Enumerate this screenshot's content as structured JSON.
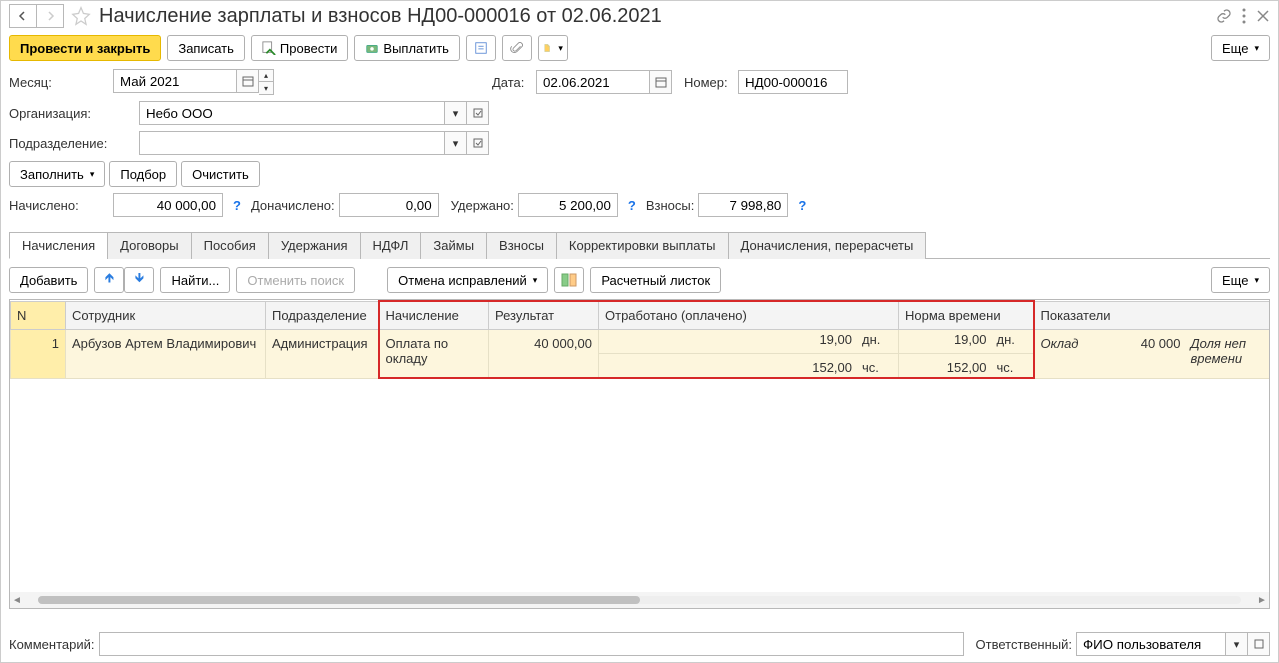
{
  "title": "Начисление зарплаты и взносов НД00-000016 от 02.06.2021",
  "toolbar": {
    "post_close": "Провести и закрыть",
    "save": "Записать",
    "post": "Провести",
    "pay": "Выплатить",
    "more": "Еще"
  },
  "fields": {
    "month_label": "Месяц:",
    "month_value": "Май 2021",
    "date_label": "Дата:",
    "date_value": "02.06.2021",
    "number_label": "Номер:",
    "number_value": "НД00-000016",
    "org_label": "Организация:",
    "org_value": "Небо ООО",
    "dept_label": "Подразделение:",
    "dept_value": ""
  },
  "actions": {
    "fill": "Заполнить",
    "pick": "Подбор",
    "clear": "Очистить"
  },
  "totals": {
    "accrued_label": "Начислено:",
    "accrued_value": "40 000,00",
    "extra_label": "Доначислено:",
    "extra_value": "0,00",
    "withheld_label": "Удержано:",
    "withheld_value": "5 200,00",
    "contrib_label": "Взносы:",
    "contrib_value": "7 998,80"
  },
  "tabs": [
    "Начисления",
    "Договоры",
    "Пособия",
    "Удержания",
    "НДФЛ",
    "Займы",
    "Взносы",
    "Корректировки выплаты",
    "Доначисления, перерасчеты"
  ],
  "tab_toolbar": {
    "add": "Добавить",
    "find": "Найти...",
    "cancel_search": "Отменить поиск",
    "cancel_fix": "Отмена исправлений",
    "payslip": "Расчетный листок",
    "more": "Еще"
  },
  "columns": {
    "n": "N",
    "employee": "Сотрудник",
    "department": "Подразделение",
    "accrual": "Начисление",
    "result": "Результат",
    "worked": "Отработано (оплачено)",
    "norm": "Норма времени",
    "indicators": "Показатели"
  },
  "row": {
    "n": "1",
    "employee": "Арбузов Артем Владимирович",
    "department": "Администрация",
    "accrual": "Оплата по окладу",
    "result": "40 000,00",
    "worked_days": "19,00",
    "worked_days_unit": "дн.",
    "worked_hours": "152,00",
    "worked_hours_unit": "чс.",
    "norm_days": "19,00",
    "norm_days_unit": "дн.",
    "norm_hours": "152,00",
    "norm_hours_unit": "чс.",
    "indicator_name": "Оклад",
    "indicator_val": "40 000",
    "indicator_extra": "Доля неп\nвремени"
  },
  "footer": {
    "comment_label": "Комментарий:",
    "resp_label": "Ответственный:",
    "resp_value": "ФИО пользователя"
  }
}
